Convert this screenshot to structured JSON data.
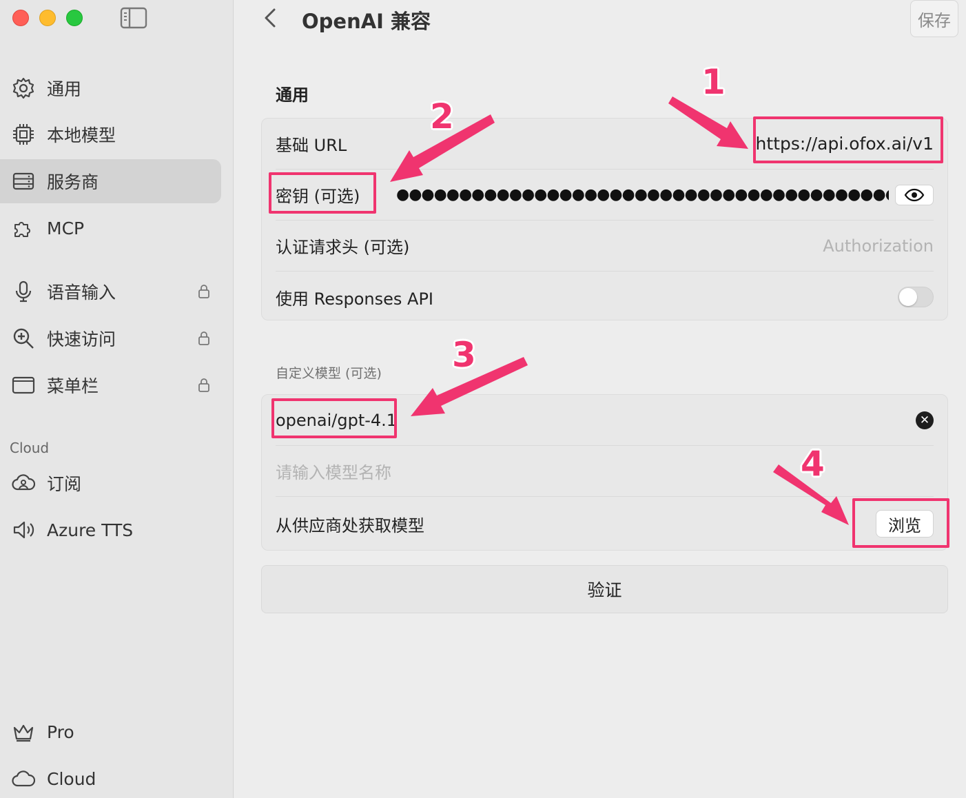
{
  "sidebar": {
    "items": [
      {
        "label": "通用",
        "icon": "gear-icon",
        "locked": false
      },
      {
        "label": "本地模型",
        "icon": "chip-icon",
        "locked": false
      },
      {
        "label": "服务商",
        "icon": "server-icon",
        "locked": false,
        "active": true
      },
      {
        "label": "MCP",
        "icon": "puzzle-icon",
        "locked": false
      },
      {
        "label": "语音输入",
        "icon": "microphone-icon",
        "locked": true
      },
      {
        "label": "快速访问",
        "icon": "zoom-in-icon",
        "locked": true
      },
      {
        "label": "菜单栏",
        "icon": "window-icon",
        "locked": true
      }
    ],
    "cloud_section": "Cloud",
    "cloud_items": [
      {
        "label": "订阅",
        "icon": "cloud-user-icon"
      },
      {
        "label": "Azure TTS",
        "icon": "speaker-icon"
      }
    ],
    "bottom_items": [
      {
        "label": "Pro",
        "icon": "crown-icon"
      },
      {
        "label": "Cloud",
        "icon": "cloud-icon"
      }
    ]
  },
  "header": {
    "title": "OpenAI 兼容",
    "save_label": "保存"
  },
  "general": {
    "title": "通用",
    "base_url_label": "基础 URL",
    "base_url_value": "https://api.ofox.ai/v1",
    "key_label": "密钥 (可选)",
    "key_masked": "●●●●●●●●●●●●●●●●●●●●●●●●●●●●●●●●●●●●●●●●●●●●●●●●",
    "auth_label": "认证请求头 (可选)",
    "auth_placeholder": "Authorization",
    "responses_label": "使用 Responses API",
    "responses_enabled": false
  },
  "models": {
    "title": "自定义模型 (可选)",
    "model_value": "openai/gpt-4.1",
    "model_placeholder": "请输入模型名称",
    "fetch_label": "从供应商处获取模型",
    "browse_label": "浏览"
  },
  "verify_label": "验证",
  "annotations": {
    "color": "#f0346f",
    "numbers": [
      "1",
      "2",
      "3",
      "4"
    ]
  }
}
